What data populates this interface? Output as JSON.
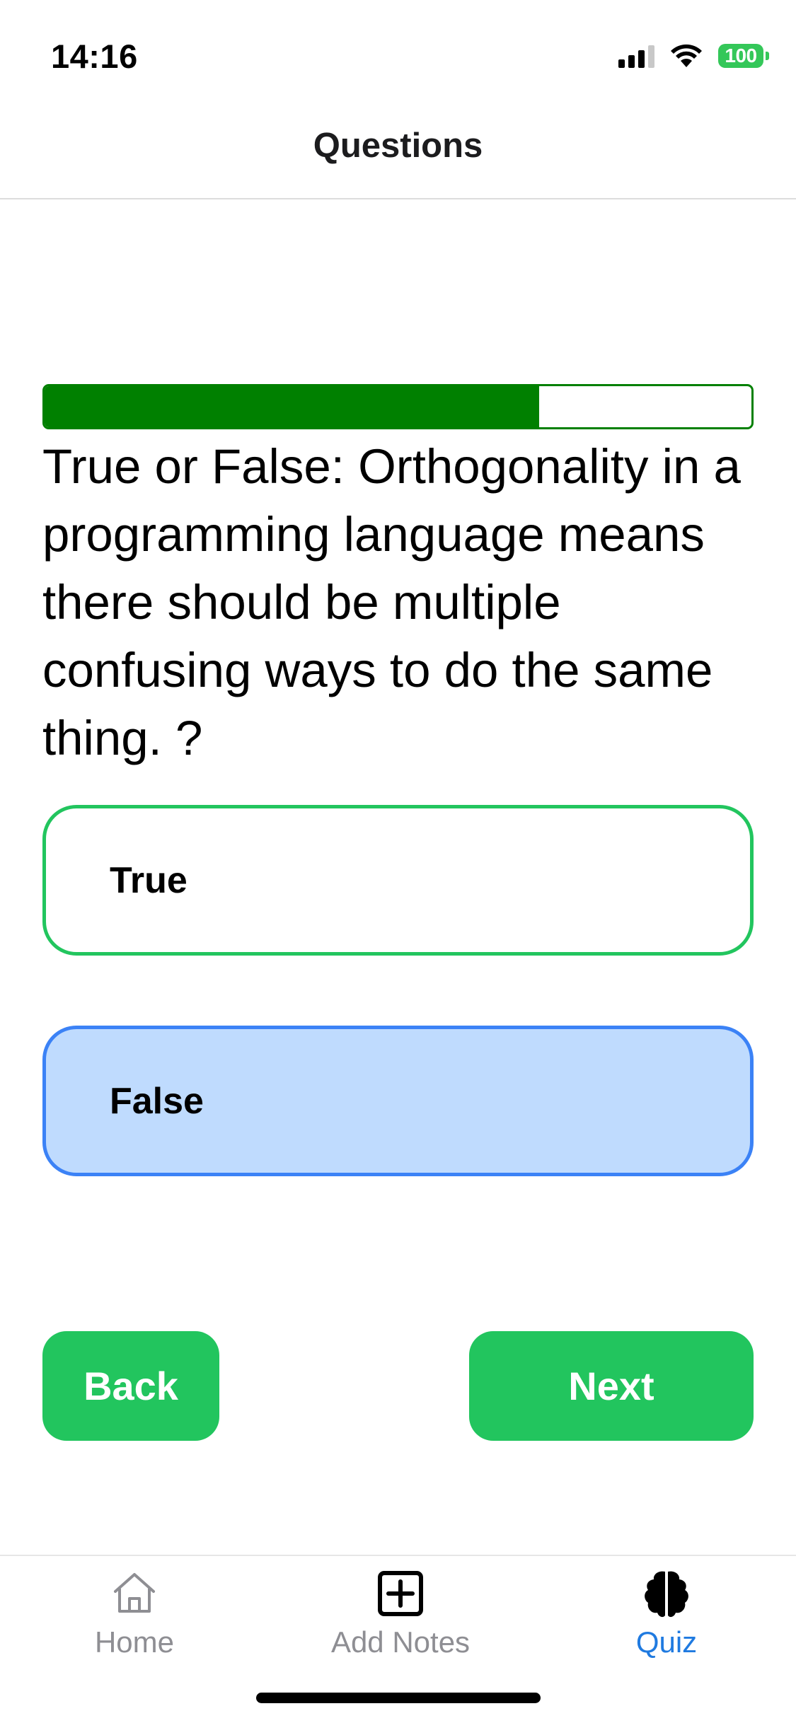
{
  "status_bar": {
    "time": "14:16",
    "battery": "100",
    "battery_color": "#34c759"
  },
  "nav": {
    "title": "Questions"
  },
  "progress": {
    "fraction": 0.7,
    "color": "#008000"
  },
  "question": {
    "text": "True or False: Orthogonality in a programming language means there should be multiple confusing ways to do the same thing. ?"
  },
  "answers": [
    {
      "label": "True",
      "border_color": "#22c55e",
      "fill": "#ffffff"
    },
    {
      "label": "False",
      "border_color": "#3b82f6",
      "fill": "#bfdbfe",
      "selected": true
    }
  ],
  "buttons": {
    "back": "Back",
    "next": "Next",
    "color": "#22c55e"
  },
  "tabs": [
    {
      "label": "Home",
      "icon": "home-icon"
    },
    {
      "label": "Add Notes",
      "icon": "plus-square-icon"
    },
    {
      "label": "Quiz",
      "icon": "brain-icon",
      "active": true
    }
  ],
  "colors": {
    "tab_active": "#1f7ae0",
    "tab_inactive": "#8e8e93"
  }
}
